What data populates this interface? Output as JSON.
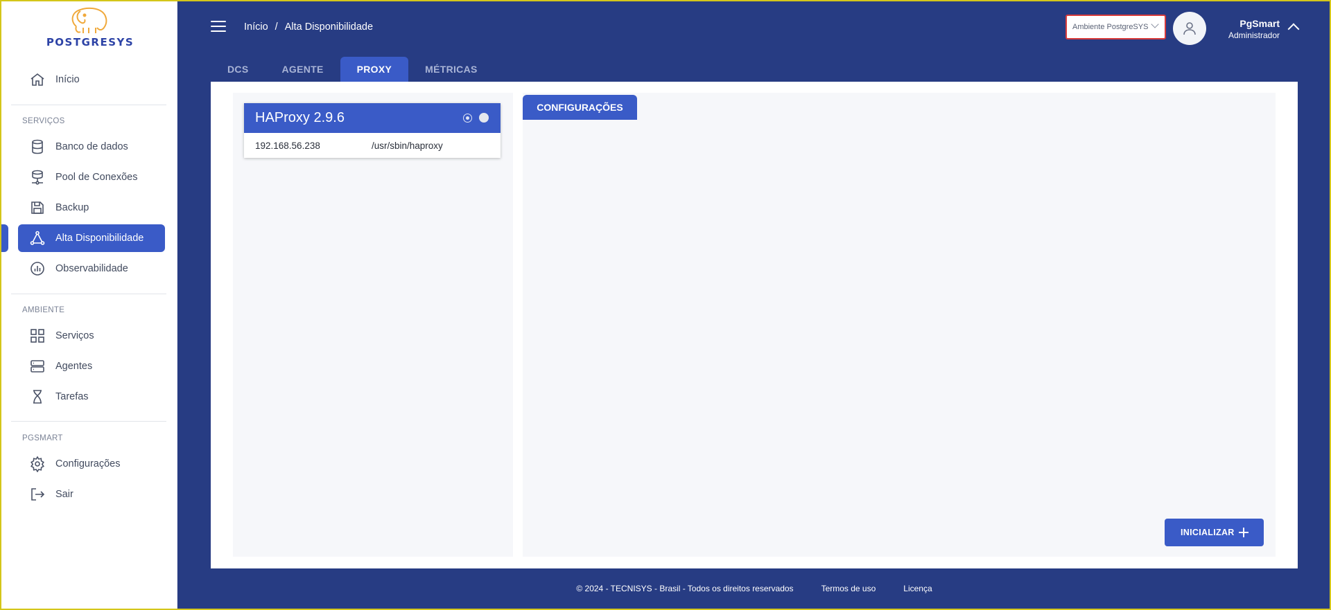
{
  "brand": {
    "name": "POSTGRESYS",
    "logo_color": "#f0a93b",
    "text_color": "#2d43a6"
  },
  "sidebar": {
    "top_item": {
      "label": "Início",
      "icon": "home-icon"
    },
    "sections": [
      {
        "label": "SERVIÇOS",
        "items": [
          {
            "label": "Banco de dados",
            "icon": "database-icon"
          },
          {
            "label": "Pool de Conexões",
            "icon": "pool-icon"
          },
          {
            "label": "Backup",
            "icon": "save-icon"
          },
          {
            "label": "Alta Disponibilidade",
            "icon": "triangle-nodes-icon",
            "active": true
          },
          {
            "label": "Observabilidade",
            "icon": "chart-icon"
          }
        ]
      },
      {
        "label": "AMBIENTE",
        "items": [
          {
            "label": "Serviços",
            "icon": "grid-icon"
          },
          {
            "label": "Agentes",
            "icon": "server-icon"
          },
          {
            "label": "Tarefas",
            "icon": "hourglass-icon"
          }
        ]
      },
      {
        "label": "PGSMART",
        "items": [
          {
            "label": "Configurações",
            "icon": "gear-icon"
          },
          {
            "label": "Sair",
            "icon": "logout-icon"
          }
        ]
      }
    ]
  },
  "header": {
    "breadcrumb": [
      "Início",
      "/",
      "Alta Disponibilidade"
    ],
    "environment_select": "Ambiente PostgreSYS",
    "user": {
      "name": "PgSmart",
      "role": "Administrador"
    }
  },
  "tabs": [
    {
      "label": "DCS",
      "active": false
    },
    {
      "label": "AGENTE",
      "active": false
    },
    {
      "label": "PROXY",
      "active": true
    },
    {
      "label": "MÉTRICAS",
      "active": false
    }
  ],
  "proxy_card": {
    "title": "HAProxy 2.9.6",
    "ip": "192.168.56.238",
    "path": "/usr/sbin/haproxy"
  },
  "config_panel": {
    "tab_label": "CONFIGURAÇÕES",
    "init_button": "INICIALIZAR"
  },
  "footer": {
    "copyright": "© 2024 - TECNISYS - Brasil - Todos os direitos reservados",
    "terms": "Termos de uso",
    "license": "Licença"
  },
  "colors": {
    "primary": "#3a5bc7",
    "header_bg": "#273c83",
    "env_select_border": "#d83b3b"
  }
}
